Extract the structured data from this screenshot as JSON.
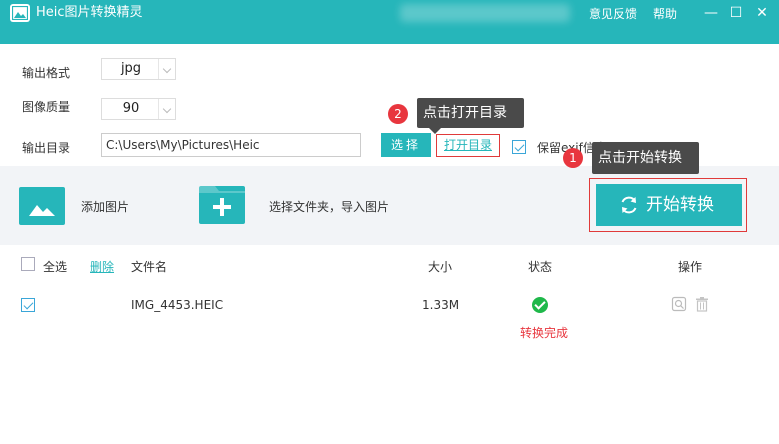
{
  "app": {
    "title": "Heic图片转换精灵"
  },
  "titlebar": {
    "feedback": "意见反馈",
    "help": "帮助",
    "minimize": "—",
    "maximize": "☐",
    "close": "✕"
  },
  "settings": {
    "format_label": "输出格式",
    "format_value": "jpg",
    "quality_label": "图像质量",
    "quality_value": "90",
    "dir_label": "输出目录",
    "dir_value": "C:\\Users\\My\\Pictures\\Heic",
    "choose_button": "选择",
    "open_dir_link": "打开目录",
    "keep_exif_label": "保留exif信息",
    "keep_exif_checked": true
  },
  "callouts": {
    "open_dir": {
      "number": "2",
      "text": "点击打开目录"
    },
    "start": {
      "number": "1",
      "text": "点击开始转换"
    }
  },
  "toolbar": {
    "add_images": "添加图片",
    "add_folder": "选择文件夹，导入图片",
    "start_button": "开始转换"
  },
  "table": {
    "select_all": "全选",
    "delete": "删除",
    "headers": {
      "name": "文件名",
      "size": "大小",
      "status": "状态",
      "operation": "操作"
    },
    "rows": [
      {
        "checked": true,
        "name": "IMG_4453.HEIC",
        "size": "1.33M",
        "status": "转换完成"
      }
    ]
  },
  "colors": {
    "accent": "#26b6ba",
    "highlight": "#e03a3a",
    "success": "#1fb84a",
    "callout": "#4a4a4a"
  }
}
